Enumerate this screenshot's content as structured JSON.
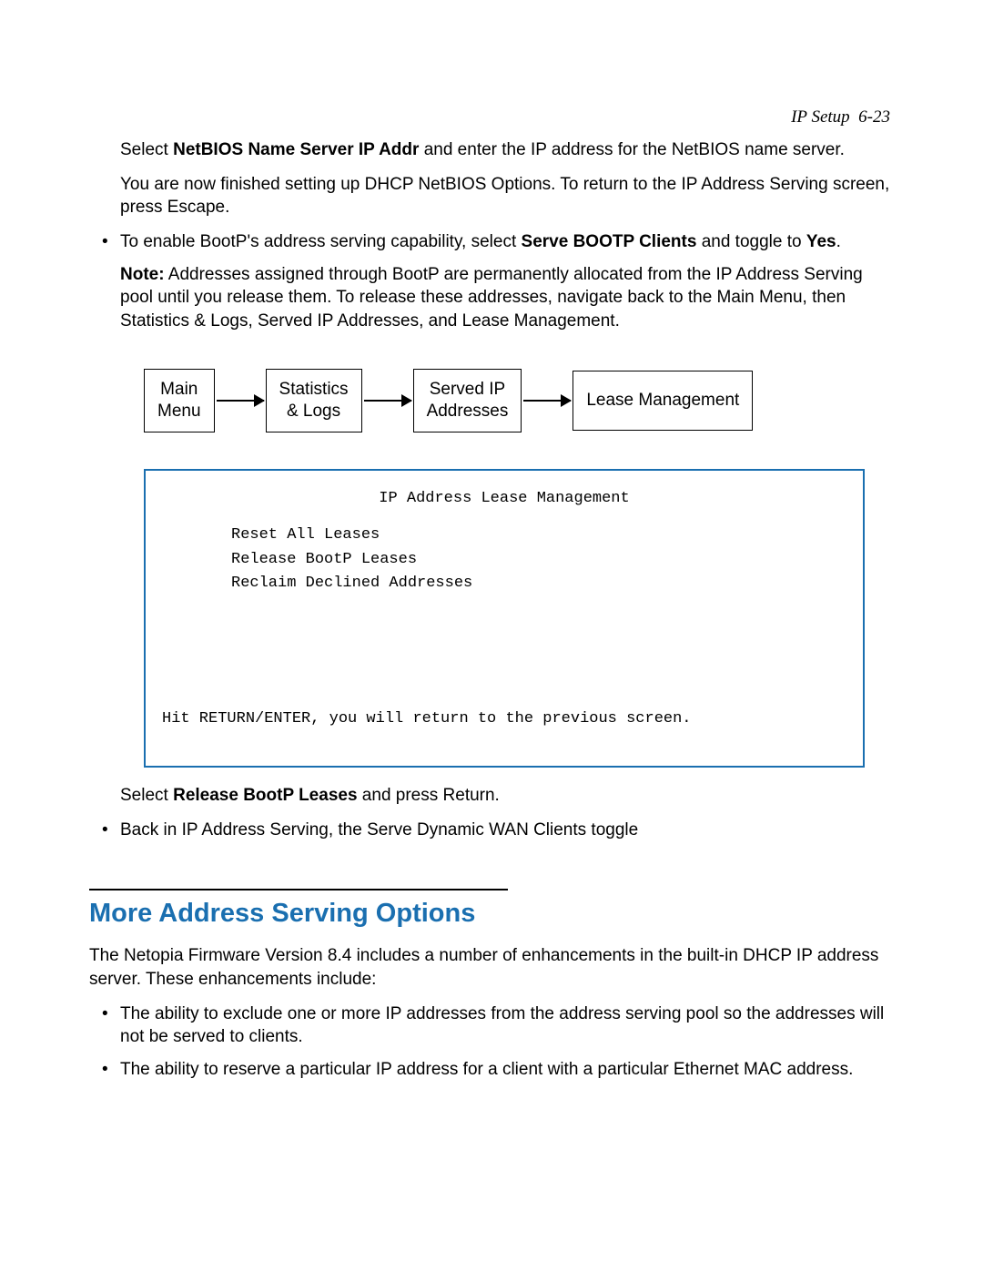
{
  "header": {
    "section": "IP Setup",
    "page": "6-23"
  },
  "p1a": "Select ",
  "p1b": "NetBIOS Name Server IP Addr",
  "p1c": " and enter the IP address for the NetBIOS name server.",
  "p2": "You are now finished setting up DHCP NetBIOS Options. To return to the IP Address Serving screen, press Escape.",
  "bul1a": "To enable BootP's address serving capability, select ",
  "bul1b": "Serve BOOTP Clients",
  "bul1c": " and toggle to ",
  "bul1d": "Yes",
  "bul1e": ".",
  "note_label": "Note:",
  "note_body": " Addresses assigned through BootP are permanently allocated from the IP Address Serving pool until you release them. To release these addresses, navigate back to the Main Menu, then Statistics & Logs, Served IP Addresses, and Lease Management.",
  "flow": {
    "b1l1": "Main",
    "b1l2": "Menu",
    "b2l1": "Statistics",
    "b2l2": "& Logs",
    "b3l1": "Served IP",
    "b3l2": "Addresses",
    "b4": "Lease Management"
  },
  "term": {
    "title": "IP Address Lease Management",
    "items": [
      "Reset All Leases",
      "Release BootP Leases",
      "Reclaim Declined Addresses"
    ],
    "footer": "Hit RETURN/ENTER, you will return to the previous screen."
  },
  "p3a": "Select ",
  "p3b": "Release BootP Leases",
  "p3c": " and press Return.",
  "bul2": "Back in IP Address Serving, the Serve Dynamic WAN Clients toggle",
  "section_title": "More Address Serving Options",
  "p4": "The Netopia Firmware Version 8.4 includes a number of enhancements in the built-in DHCP IP address server. These enhancements include:",
  "bul3": "The ability to exclude one or more IP addresses from the address serving pool so the addresses will not be served to clients.",
  "bul4": "The ability to reserve a particular IP address for a client with a particular Ethernet MAC address.",
  "bullet_glyph": "•"
}
